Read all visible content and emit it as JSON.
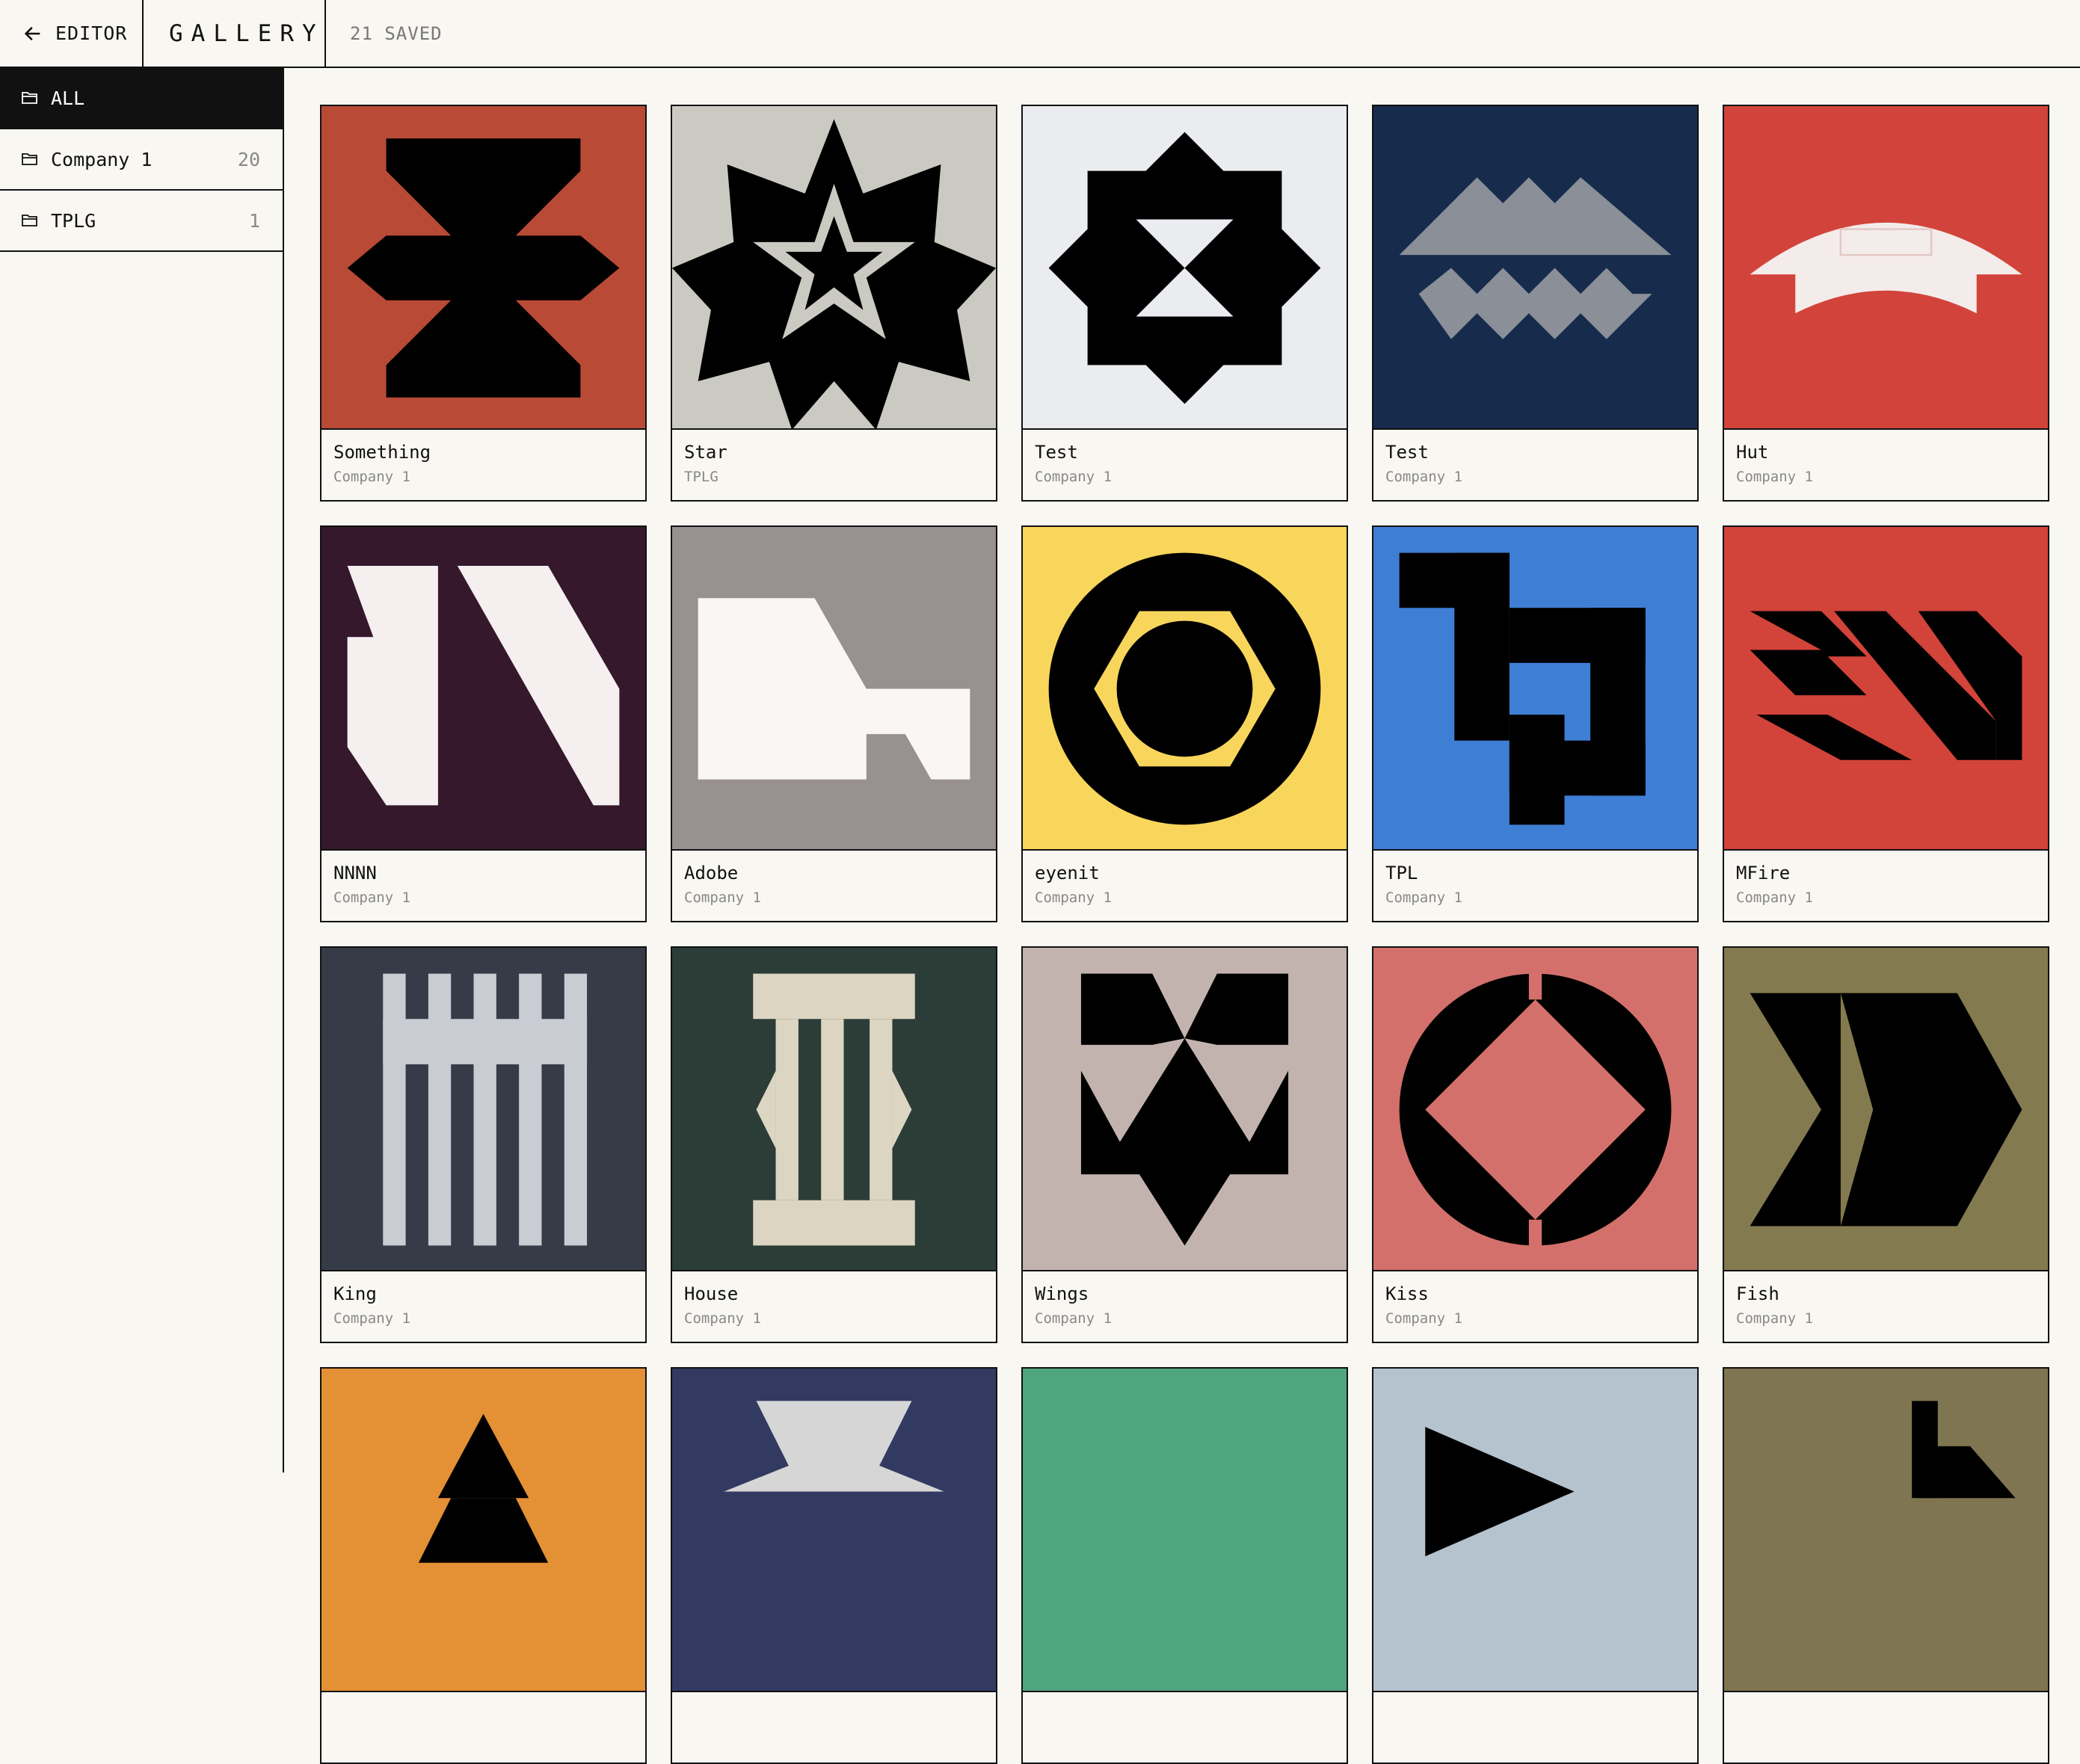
{
  "header": {
    "back_label": "EDITOR",
    "brand": "GALLERY",
    "saved_count": "21 SAVED"
  },
  "sidebar": {
    "folders": [
      {
        "label": "ALL",
        "count": ""
      },
      {
        "label": "Company 1",
        "count": "20"
      },
      {
        "label": "TPLG",
        "count": "1"
      }
    ]
  },
  "cards": [
    {
      "title": "Something",
      "folder": "Company 1",
      "bg": "#b94a36",
      "icon": "something-glyph"
    },
    {
      "title": "Star",
      "folder": "TPLG",
      "bg": "#cbcac2",
      "icon": "star-glyph"
    },
    {
      "title": "Test",
      "folder": "Company 1",
      "bg": "#ebecf0",
      "icon": "octagram-glyph"
    },
    {
      "title": "Test",
      "folder": "Company 1",
      "bg": "#172c4c",
      "icon": "zigzag-glyph"
    },
    {
      "title": "Hut",
      "folder": "Company 1",
      "bg": "#d2443b",
      "icon": "arch-glyph"
    },
    {
      "title": "NNNN",
      "folder": "Company 1",
      "bg": "#36182d",
      "icon": "nn-glyph"
    },
    {
      "title": "Adobe",
      "folder": "Company 1",
      "bg": "#99918f",
      "icon": "adobe-glyph"
    },
    {
      "title": "eyenit",
      "folder": "Company 1",
      "bg": "#f7d65b",
      "icon": "eye-glyph"
    },
    {
      "title": "TPL",
      "folder": "Company 1",
      "bg": "#3f7ed5",
      "icon": "tpl-glyph"
    },
    {
      "title": "MFire",
      "folder": "Company 1",
      "bg": "#d2433a",
      "icon": "stripes-glyph"
    },
    {
      "title": "King",
      "folder": "Company 1",
      "bg": "#363c47",
      "icon": "king-glyph"
    },
    {
      "title": "House",
      "folder": "Company 1",
      "bg": "#2c3d38",
      "icon": "columns-glyph"
    },
    {
      "title": "Wings",
      "folder": "Company 1",
      "bg": "#c3b3ae",
      "icon": "wings-glyph"
    },
    {
      "title": "Kiss",
      "folder": "Company 1",
      "bg": "#d4706b",
      "icon": "kiss-glyph"
    },
    {
      "title": "Fish",
      "folder": "Company 1",
      "bg": "#837a4f",
      "icon": "fish-glyph"
    },
    {
      "title": "",
      "folder": "",
      "bg": "#e49034",
      "icon": "triangle-glyph"
    },
    {
      "title": "",
      "folder": "",
      "bg": "#323a62",
      "icon": "funnel-glyph"
    },
    {
      "title": "",
      "folder": "",
      "bg": "#4fa67e",
      "icon": "blank-glyph"
    },
    {
      "title": "",
      "folder": "",
      "bg": "#b4c3ce",
      "icon": "play-glyph"
    },
    {
      "title": "",
      "folder": "",
      "bg": "#7f7651",
      "icon": "step-glyph"
    }
  ]
}
